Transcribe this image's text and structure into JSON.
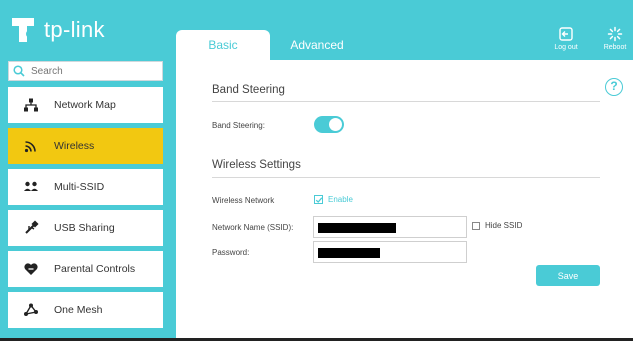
{
  "brand": {
    "logo_text": "tp-link"
  },
  "tabs": [
    {
      "label": "Basic",
      "active": true
    },
    {
      "label": "Advanced",
      "active": false
    }
  ],
  "header_buttons": {
    "logout": "Log out",
    "reboot": "Reboot"
  },
  "search": {
    "placeholder": "Search"
  },
  "sidebar": {
    "items": [
      {
        "label": "Network Map",
        "icon": "network-map-icon",
        "active": false
      },
      {
        "label": "Wireless",
        "icon": "wifi-icon",
        "active": true
      },
      {
        "label": "Multi-SSID",
        "icon": "multi-ssid-icon",
        "active": false
      },
      {
        "label": "USB Sharing",
        "icon": "usb-icon",
        "active": false
      },
      {
        "label": "Parental Controls",
        "icon": "heart-shield-icon",
        "active": false
      },
      {
        "label": "One Mesh",
        "icon": "mesh-icon",
        "active": false
      }
    ]
  },
  "main": {
    "band_steering": {
      "title": "Band Steering",
      "label": "Band Steering:",
      "enabled": true
    },
    "wireless_settings": {
      "title": "Wireless Settings",
      "network_label": "Wireless Network",
      "enable_label": "Enable",
      "enable_checked": true,
      "ssid_label": "Network Name (SSID):",
      "hide_ssid_label": "Hide SSID",
      "hide_ssid_checked": false,
      "password_label": "Password:"
    },
    "save_label": "Save",
    "help_glyph": "?"
  },
  "colors": {
    "accent": "#4acbd6",
    "active_nav": "#f2c811"
  }
}
